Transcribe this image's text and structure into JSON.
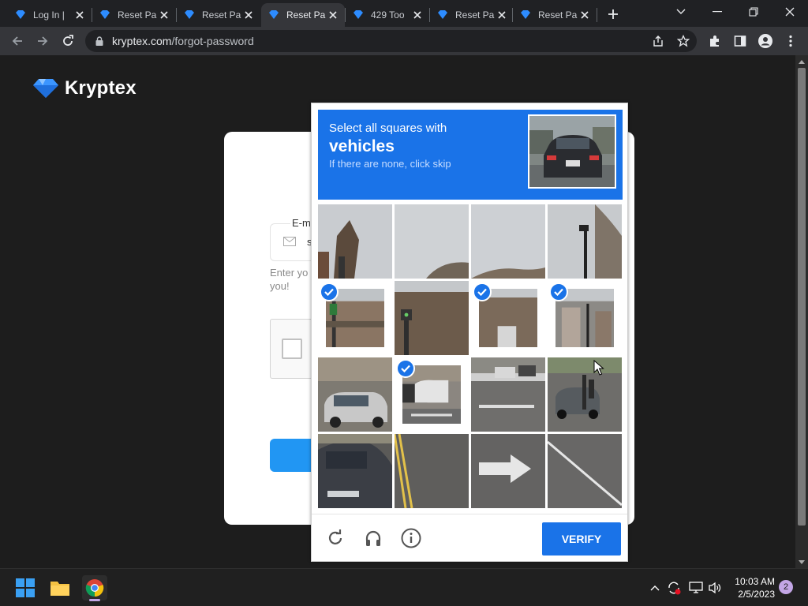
{
  "browser": {
    "tabs": [
      {
        "title": "Log In |",
        "active": false
      },
      {
        "title": "Reset Pa",
        "active": false
      },
      {
        "title": "Reset Pa",
        "active": false
      },
      {
        "title": "Reset Pa",
        "active": true
      },
      {
        "title": "429 Too",
        "active": false
      },
      {
        "title": "Reset Pa",
        "active": false
      },
      {
        "title": "Reset Pa",
        "active": false
      }
    ],
    "url_host": "kryptex.com",
    "url_path": "/forgot-password"
  },
  "page": {
    "logo_text": "Kryptex",
    "email_legend": "E-m",
    "email_value": "s",
    "hint_text": "Enter yo you!",
    "brand_color": "#2196f3"
  },
  "captcha": {
    "instruction_line1": "Select all squares with",
    "instruction_keyword": "vehicles",
    "instruction_line3": "If there are none, click skip",
    "verify_label": "VERIFY",
    "selected_tiles": [
      4,
      6,
      7,
      9
    ],
    "accent_color": "#1a73e8",
    "footer_icons": [
      "reload-icon",
      "audio-icon",
      "info-icon"
    ]
  },
  "taskbar": {
    "time": "10:03 AM",
    "date": "2/5/2023",
    "notification_count": "2"
  }
}
